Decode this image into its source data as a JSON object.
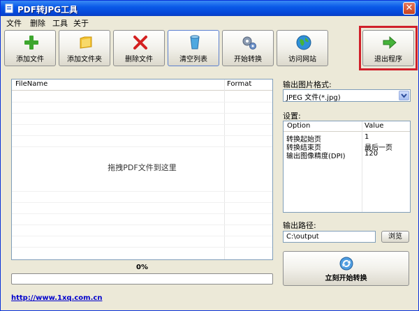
{
  "window": {
    "title": "PDF转JPG工具",
    "close_symbol": "✕"
  },
  "menu": [
    "文件",
    "删除",
    "工具",
    "关于"
  ],
  "toolbar": [
    {
      "label": "添加文件",
      "icon": "plus-icon"
    },
    {
      "label": "添加文件夹",
      "icon": "folder-icon"
    },
    {
      "label": "删除文件",
      "icon": "delete-x-icon"
    },
    {
      "label": "清空列表",
      "icon": "clear-list-icon"
    },
    {
      "label": "开始转换",
      "icon": "gears-icon"
    },
    {
      "label": "访问网站",
      "icon": "globe-icon"
    },
    {
      "label": "退出程序",
      "icon": "arrow-right-icon"
    }
  ],
  "file_list": {
    "columns": [
      "FileName",
      "Format"
    ],
    "drop_hint": "拖拽PDF文件到这里"
  },
  "progress": {
    "text": "0%",
    "value": 0
  },
  "link": "http://www.1xq.com.cn",
  "output_format": {
    "label": "输出图片格式:",
    "selected": "JPEG 文件(*.jpg)"
  },
  "settings": {
    "label": "设置:",
    "columns": [
      "Option",
      "Value"
    ],
    "rows": [
      {
        "option": "转换起始页",
        "value": "1"
      },
      {
        "option": "转换结束页",
        "value": "最后一页"
      },
      {
        "option": "输出图像精度(DPI)",
        "value": "120"
      }
    ]
  },
  "output_path": {
    "label": "输出路径:",
    "value": "C:\\output",
    "browse_label": "浏览"
  },
  "start_button": {
    "label": "立刻开始转换"
  },
  "colors": {
    "highlight": "#d0202a",
    "titlebar": "#0a5ae8"
  }
}
